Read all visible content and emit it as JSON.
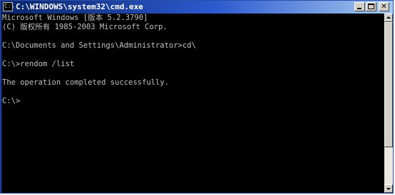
{
  "window": {
    "title": "C:\\WINDOWS\\system32\\cmd.exe",
    "icon_label": "C:\\",
    "icon": "cmd-icon",
    "buttons": {
      "minimize_icon": "minimize-icon",
      "maximize_icon": "maximize-icon",
      "close_icon": "close-icon",
      "close_glyph": "✕"
    }
  },
  "console": {
    "lines": [
      "Microsoft Windows [版本 5.2.3790]",
      "(C) 版权所有 1985-2003 Microsoft Corp.",
      "",
      "C:\\Documents and Settings\\Administrator>cd\\",
      "",
      "C:\\>rendom /list",
      "",
      "The operation completed successfully.",
      "",
      "C:\\>"
    ]
  },
  "colors": {
    "console_background": "#000000",
    "console_text": "#c0c0c0",
    "titlebar_start": "#0a246a",
    "titlebar_end": "#a6caf0"
  }
}
